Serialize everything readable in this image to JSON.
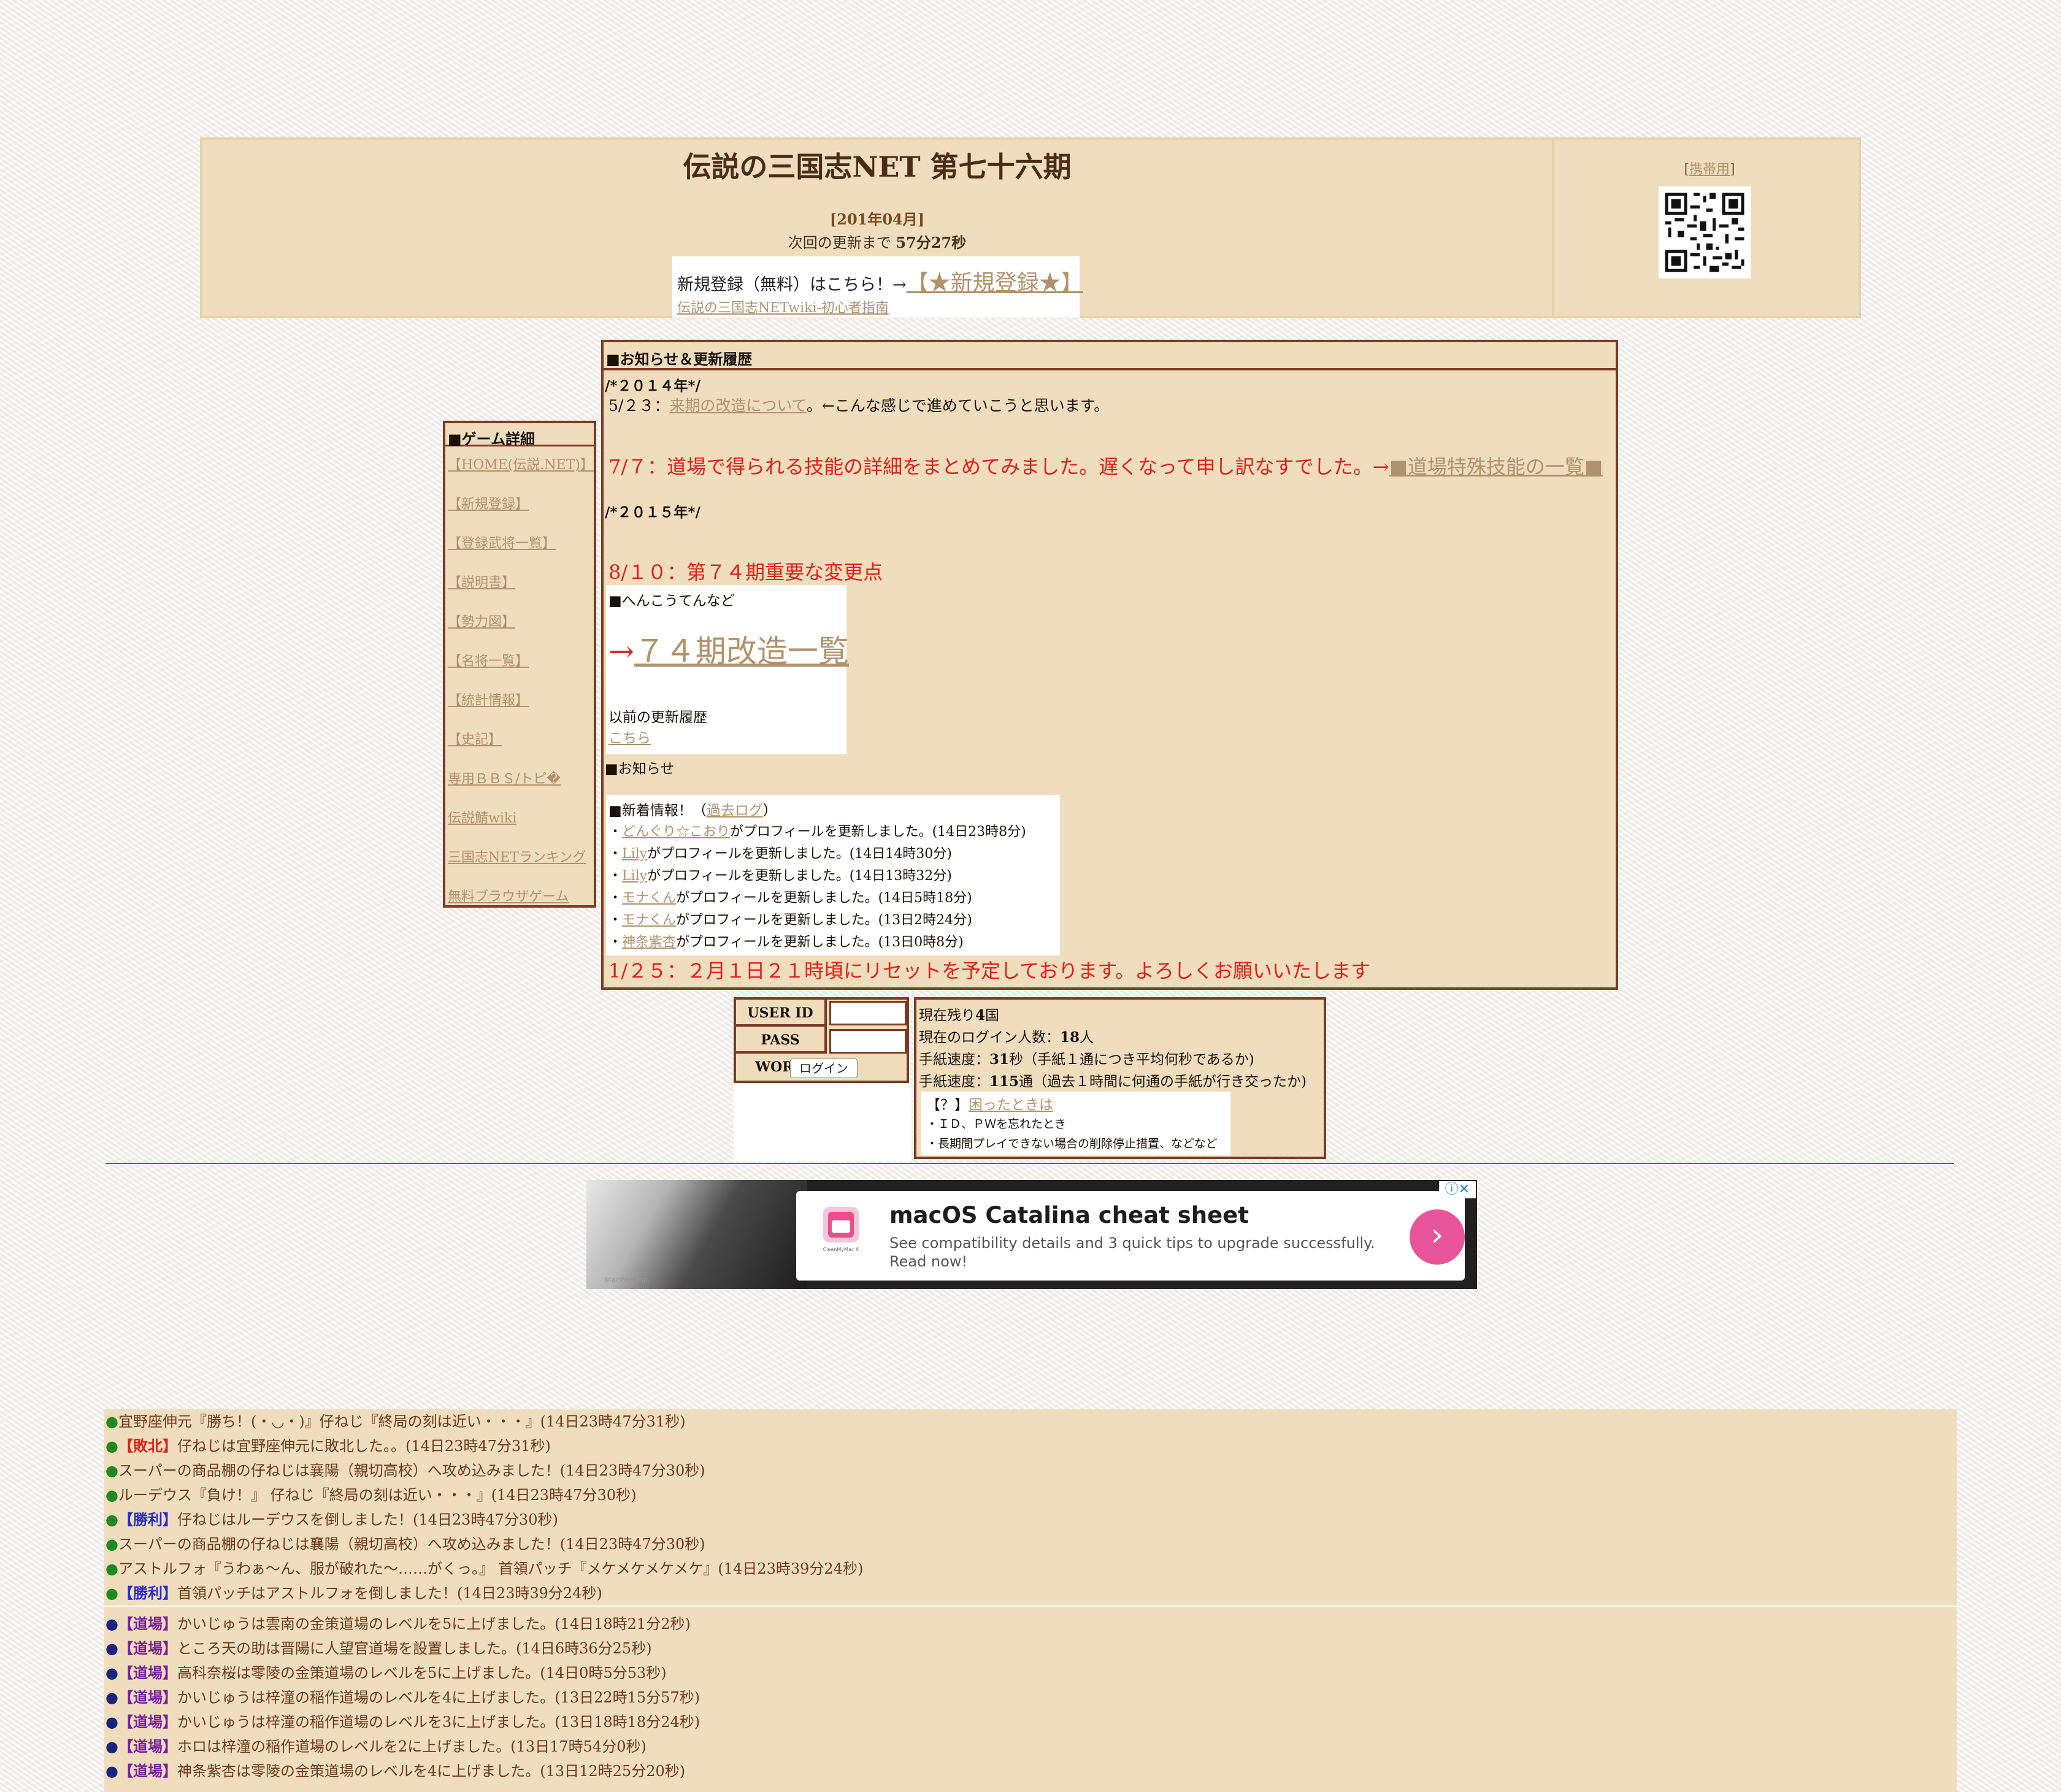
{
  "header": {
    "title": "伝説の三国志NET 第七十六期",
    "date": "[201年04月]",
    "next_update_prefix": "次回の更新まで ",
    "next_update_time": "57分27秒",
    "register_prefix": "新規登録（無料）はこちら！→",
    "register_link": "【★新規登録★】",
    "wiki_link": "伝説の三国志NETwiki-初心者指南",
    "mobile_bracket_left": "[",
    "mobile_link": "携帯用",
    "mobile_bracket_right": "]"
  },
  "menu": {
    "title": "■ゲーム詳細",
    "items": [
      "【HOME(伝説.NET)】",
      "【新規登録】",
      "【登録武将一覧】",
      "【説明書】",
      "【勢力図】",
      "【名将一覧】",
      "【統計情報】",
      "【史記】",
      "専用ＢＢＳ/トピ�",
      "伝説鯖wiki",
      "三国志NETランキング",
      "無料ブラウザゲーム"
    ]
  },
  "news": {
    "title": "■お知らせ＆更新履歴",
    "year2014": "/*２０１４年*/",
    "line_523_prefix": "5/２３：",
    "line_523_link": "来期の改造について",
    "line_523_suffix": "。←こんな感じで進めていこうと思います。",
    "line_77_text": "7/７：道場で得られる技能の詳細をまとめてみました。遅くなって申し訳なすでした。→",
    "line_77_link": "■道場特殊技能の一覧■",
    "year2015": "/*２０１５年*/",
    "line_810": "8/１０：第７４期重要な変更点",
    "henkou_label": "■へんこうてんなど",
    "kaizou_arrow": "→",
    "kaizou_link": "７４期改造一覧",
    "previous_label": "以前の更新履歴",
    "previous_link": "こちら",
    "notice_label": "■お知らせ",
    "new_info_label": "■新着情報！（",
    "past_log_link": "過去ログ",
    "new_info_close": "）",
    "updates": [
      {
        "bullet": "・",
        "name": "どんぐり☆こおり",
        "text": "がプロフィールを更新しました。(14日23時8分)"
      },
      {
        "bullet": "・",
        "name": "Lily",
        "text": "がプロフィールを更新しました。(14日14時30分)"
      },
      {
        "bullet": "・",
        "name": "Lily",
        "text": "がプロフィールを更新しました。(14日13時32分)"
      },
      {
        "bullet": "・",
        "name": "モナくん",
        "text": "がプロフィールを更新しました。(14日5時18分)"
      },
      {
        "bullet": "・",
        "name": "モナくん",
        "text": "がプロフィールを更新しました。(13日2時24分)"
      },
      {
        "bullet": "・",
        "name": "神条紫杏",
        "text": "がプロフィールを更新しました。(13日0時8分)"
      }
    ],
    "line_125": "1/２５：２月１日２１時頃にリセットを予定しております。よろしくお願いいたします"
  },
  "login": {
    "user_label": "USER ID",
    "pass_label": "PASS WORD",
    "user_value": "",
    "pass_value": "",
    "button": "ログイン"
  },
  "status": {
    "remaining_prefix": "現在残り",
    "remaining_value": "4",
    "remaining_suffix": "国",
    "login_prefix": "現在のログイン人数：",
    "login_value": "18",
    "login_suffix": "人",
    "speed1_prefix": "手紙速度：",
    "speed1_value": "31",
    "speed1_suffix": "秒（手紙１通につき平均何秒であるか)",
    "speed2_prefix": "手紙速度：",
    "speed2_value": "115",
    "speed2_suffix": "通（過去１時間に何通の手紙が行き交ったか)",
    "help_prefix": "【？】",
    "help_link": "困ったときは",
    "help_item1": "・ＩＤ、ＰＷを忘れたとき",
    "help_item2": "・長期間プレイできない場合の削除停止措置、などなど"
  },
  "ad": {
    "title": "macOS Catalina cheat sheet",
    "desc1": "See compatibility details and 3 quick tips to upgrade successfully.",
    "desc2": "Read now!",
    "go": "›",
    "choice": "ⓘ✕",
    "footer": "MacPaw Inc.",
    "icon_label": "CleanMyMac X"
  },
  "log": {
    "entries": [
      {
        "mark": "●",
        "mark_color": "green",
        "tag": "",
        "text": "宜野座伸元『勝ち！(・◡・)』仔ねじ『終局の刻は近い・・・』(14日23時47分31秒)"
      },
      {
        "mark": "●",
        "mark_color": "green",
        "tag": "【敗北】",
        "tag_color": "red",
        "text": "仔ねじは宜野座伸元に敗北した。。(14日23時47分31秒)"
      },
      {
        "mark": "●",
        "mark_color": "green",
        "tag": "",
        "text": "スーパーの商品棚の仔ねじは襄陽（親切高校）へ攻め込みました！(14日23時47分30秒)"
      },
      {
        "mark": "●",
        "mark_color": "green",
        "tag": "",
        "text": "ルーデウス『負け！』 仔ねじ『終局の刻は近い・・・』(14日23時47分30秒)"
      },
      {
        "mark": "●",
        "mark_color": "green",
        "tag": "【勝利】",
        "tag_color": "blue",
        "text": "仔ねじはルーデウスを倒しました！(14日23時47分30秒)"
      },
      {
        "mark": "●",
        "mark_color": "green",
        "tag": "",
        "text": "スーパーの商品棚の仔ねじは襄陽（親切高校）へ攻め込みました！(14日23時47分30秒)"
      },
      {
        "mark": "●",
        "mark_color": "green",
        "tag": "",
        "text": "アストルフォ『うわぁ〜ん、服が破れた〜……がくっ。』 首領パッチ『メケメケメケメケ』(14日23時39分24秒)"
      },
      {
        "mark": "●",
        "mark_color": "green",
        "tag": "【勝利】",
        "tag_color": "blue",
        "text": "首領パッチはアストルフォを倒しました！(14日23時39分24秒)"
      },
      {
        "mark": "●",
        "mark_color": "navy",
        "tag": "【道場】",
        "tag_color": "purple",
        "text": "かいじゅうは雲南の金策道場のレベルを5に上げました。(14日18時21分2秒)"
      },
      {
        "mark": "●",
        "mark_color": "navy",
        "tag": "【道場】",
        "tag_color": "purple",
        "text": "ところ天の助は晋陽に人望官道場を設置しました。(14日6時36分25秒)"
      },
      {
        "mark": "●",
        "mark_color": "navy",
        "tag": "【道場】",
        "tag_color": "purple",
        "text": "高科奈桜は零陵の金策道場のレベルを5に上げました。(14日0時5分53秒)"
      },
      {
        "mark": "●",
        "mark_color": "navy",
        "tag": "【道場】",
        "tag_color": "purple",
        "text": "かいじゅうは梓潼の稲作道場のレベルを4に上げました。(13日22時15分57秒)"
      },
      {
        "mark": "●",
        "mark_color": "navy",
        "tag": "【道場】",
        "tag_color": "purple",
        "text": "かいじゅうは梓潼の稲作道場のレベルを3に上げました。(13日18時18分24秒)"
      },
      {
        "mark": "●",
        "mark_color": "navy",
        "tag": "【道場】",
        "tag_color": "purple",
        "text": "ホロは梓潼の稲作道場のレベルを2に上げました。(13日17時54分0秒)"
      },
      {
        "mark": "●",
        "mark_color": "navy",
        "tag": "【道場】",
        "tag_color": "purple",
        "text": "神条紫杏は零陵の金策道場のレベルを4に上げました。(13日12時25分20秒)"
      }
    ]
  }
}
